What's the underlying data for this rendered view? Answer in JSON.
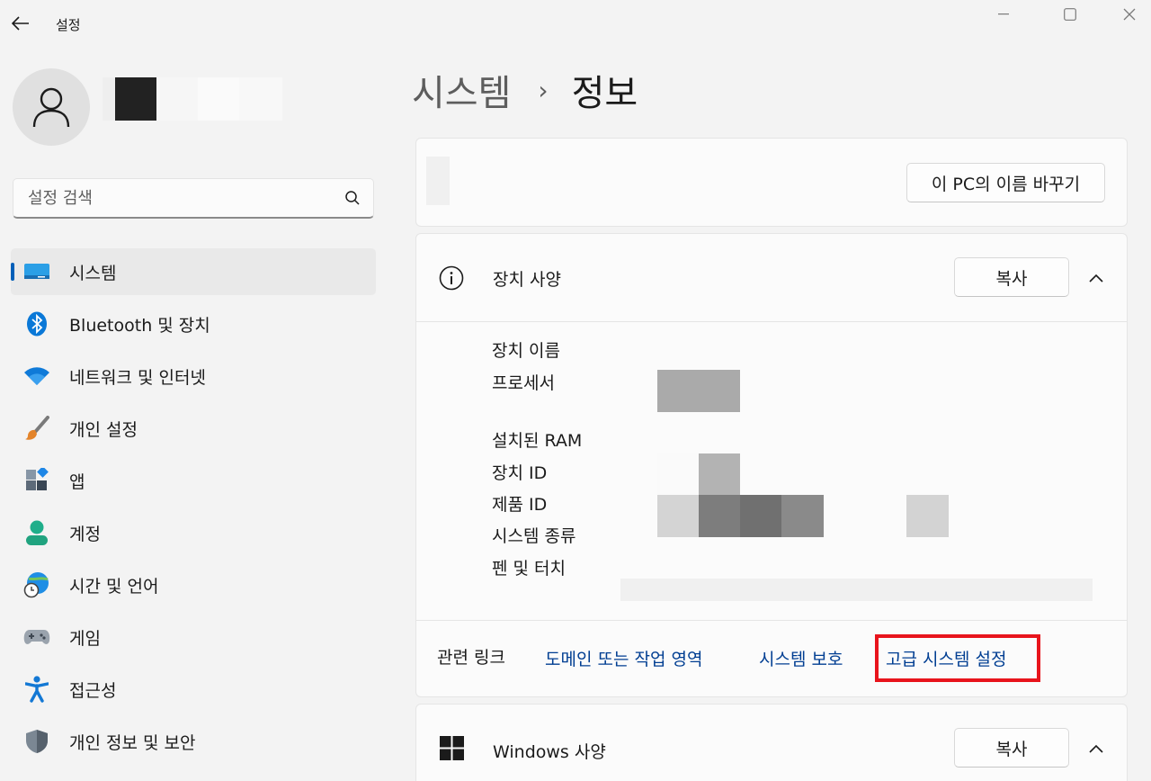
{
  "window": {
    "title": "설정",
    "back_icon": "back-arrow-icon",
    "controls": [
      "minimize-icon",
      "maximize-icon",
      "close-icon"
    ]
  },
  "sidebar": {
    "search": {
      "placeholder": "설정 검색",
      "value": ""
    },
    "items": [
      {
        "label": "시스템",
        "icon": "system-display-icon",
        "active": true
      },
      {
        "label": "Bluetooth 및 장치",
        "icon": "bluetooth-icon",
        "active": false
      },
      {
        "label": "네트워크 및 인터넷",
        "icon": "wifi-icon",
        "active": false
      },
      {
        "label": "개인 설정",
        "icon": "paintbrush-icon",
        "active": false
      },
      {
        "label": "앱",
        "icon": "apps-icon",
        "active": false
      },
      {
        "label": "계정",
        "icon": "account-icon",
        "active": false
      },
      {
        "label": "시간 및 언어",
        "icon": "time-language-icon",
        "active": false
      },
      {
        "label": "게임",
        "icon": "gamepad-icon",
        "active": false
      },
      {
        "label": "접근성",
        "icon": "accessibility-icon",
        "active": false
      },
      {
        "label": "개인 정보 및 보안",
        "icon": "shield-icon",
        "active": false
      }
    ]
  },
  "main": {
    "breadcrumb": {
      "parent": "시스템",
      "separator": "›",
      "current": "정보"
    },
    "rename_button": "이 PC의 이름 바꾸기",
    "device_specs": {
      "title": "장치 사양",
      "copy_button": "복사",
      "labels": [
        "장치 이름",
        "프로세서",
        "설치된 RAM",
        "장치 ID",
        "제품 ID",
        "시스템 종류",
        "펜 및 터치"
      ]
    },
    "related": {
      "title": "관련 링크",
      "links": [
        "도메인 또는 작업 영역",
        "시스템 보호",
        "고급 시스템 설정"
      ]
    },
    "windows_specs": {
      "title": "Windows 사양",
      "copy_button": "복사"
    }
  },
  "colors": {
    "accent": "#005fb8",
    "link": "#003e92",
    "highlight": "#e8141c",
    "background": "#f3f3f3",
    "card": "#fbfbfb"
  }
}
